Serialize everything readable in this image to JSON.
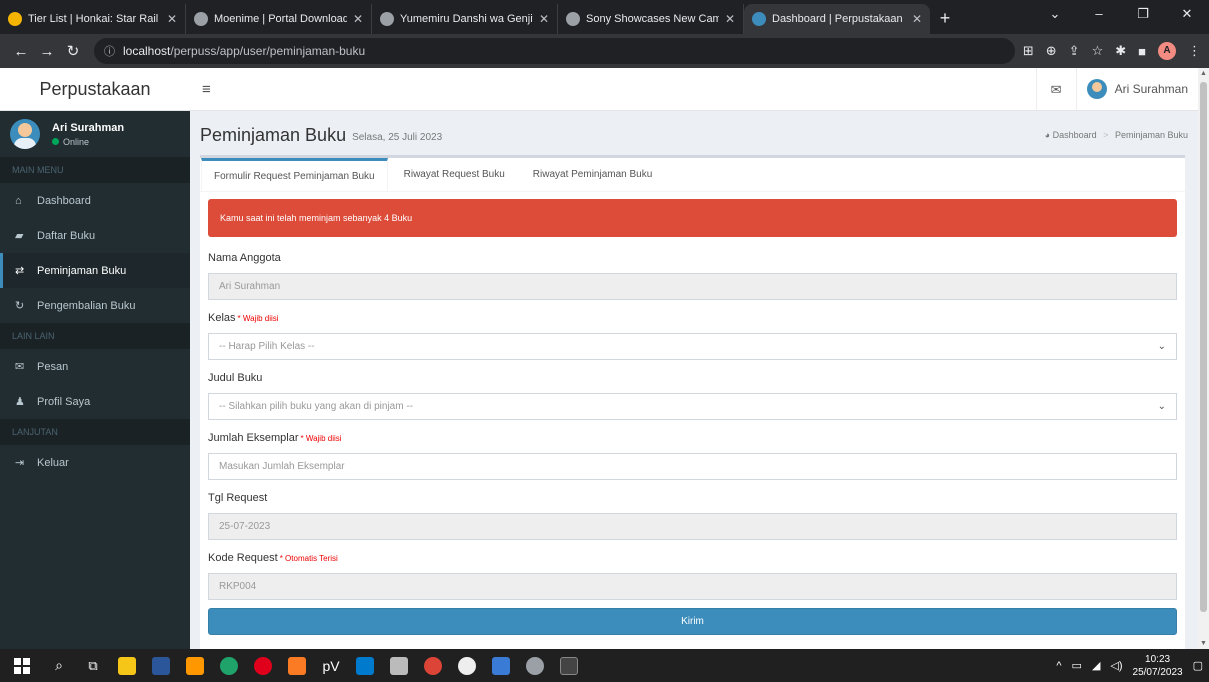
{
  "browser": {
    "tabs": [
      {
        "title": "Tier List | Honkai: Star Rail | P",
        "color": "#f4b400"
      },
      {
        "title": "Moenime | Portal Download",
        "color": "#9aa0a6"
      },
      {
        "title": "Yumemiru Danshi wa Genjits",
        "color": "#9aa0a6"
      },
      {
        "title": "Sony Showcases New Camer",
        "color": "#9aa0a6"
      },
      {
        "title": "Dashboard | Perpustakaan SI",
        "color": "#3c8dbc"
      }
    ],
    "url_host": "localhost",
    "url_path": "/perpuss/app/user/peminjaman-buku",
    "profile_initial": "A"
  },
  "app": {
    "logo": "Perpustakaan",
    "top_user": "Ari Surahman"
  },
  "sidebar": {
    "user_name": "Ari Surahman",
    "user_status": "Online",
    "sections": [
      {
        "header": "MAIN MENU",
        "items": [
          {
            "label": "Dashboard",
            "icon": "home-icon"
          },
          {
            "label": "Daftar Buku",
            "icon": "book-icon"
          },
          {
            "label": "Peminjaman Buku",
            "icon": "exchange-icon"
          },
          {
            "label": "Pengembalian Buku",
            "icon": "refresh-icon"
          }
        ]
      },
      {
        "header": "LAIN LAIN",
        "items": [
          {
            "label": "Pesan",
            "icon": "envelope-icon"
          },
          {
            "label": "Profil Saya",
            "icon": "user-icon"
          }
        ]
      },
      {
        "header": "LANJUTAN",
        "items": [
          {
            "label": "Keluar",
            "icon": "sign-out-icon"
          }
        ]
      }
    ]
  },
  "page": {
    "title": "Peminjaman Buku",
    "subtitle": "Selasa, 25 Juli 2023",
    "breadcrumb": [
      "Dashboard",
      "Peminjaman Buku"
    ]
  },
  "tabs": [
    "Formulir Request Peminjaman Buku",
    "Riwayat Request Buku",
    "Riwayat Peminjaman Buku"
  ],
  "alert": "Kamu saat ini telah meminjam sebanyak 4 Buku",
  "form": {
    "nama_label": "Nama Anggota",
    "nama_value": "Ari Surahman",
    "kelas_label": "Kelas",
    "kelas_req": "* Wajib diisi",
    "kelas_value": "-- Harap Pilih Kelas --",
    "judul_label": "Judul Buku",
    "judul_value": "-- Silahkan pilih buku yang akan di pinjam --",
    "jumlah_label": "Jumlah Eksemplar",
    "jumlah_req": "* Wajib diisi",
    "jumlah_placeholder": "Masukan Jumlah Eksemplar",
    "tgl_label": "Tgl Request",
    "tgl_value": "25-07-2023",
    "kode_label": "Kode Request",
    "kode_req": "* Otomatis Terisi",
    "kode_value": "RKP004",
    "submit": "Kirim"
  },
  "taskbar": {
    "time": "10:23",
    "date": "25/07/2023"
  },
  "colors": {
    "primary": "#3c8dbc",
    "danger": "#dd4b39",
    "sidebar": "#222d32"
  }
}
